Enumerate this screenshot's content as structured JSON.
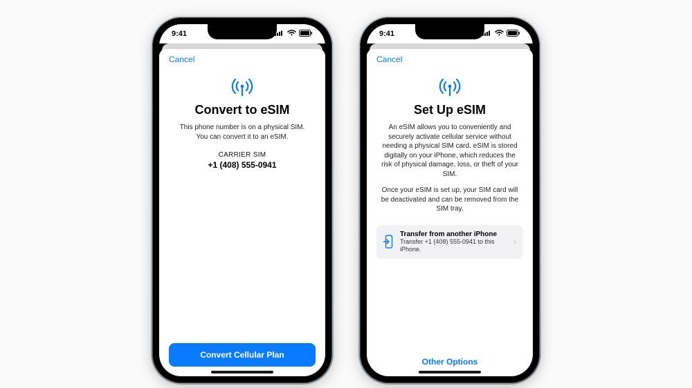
{
  "statusbar": {
    "time": "9:41"
  },
  "common": {
    "cancel": "Cancel"
  },
  "left": {
    "title": "Convert to eSIM",
    "description": "This phone number is on a physical SIM. You can convert it to an eSIM.",
    "carrier_label": "CARRIER SIM",
    "carrier_number": "+1 (408) 555-0941",
    "primary_button": "Convert Cellular Plan"
  },
  "right": {
    "title": "Set Up eSIM",
    "description1": "An eSIM allows you to conveniently and securely activate cellular service without needing a physical SIM card. eSIM is stored digitally on your iPhone, which reduces the risk of physical damage, loss, or theft of your SIM.",
    "description2": "Once your eSIM is set up, your SIM card will be deactivated and can be removed from the SIM tray.",
    "option_title": "Transfer from another iPhone",
    "option_subtitle": "Transfer +1 (408) 555-0941 to this iPhone.",
    "other_options": "Other Options"
  },
  "colors": {
    "accent": "#0a7aff"
  }
}
